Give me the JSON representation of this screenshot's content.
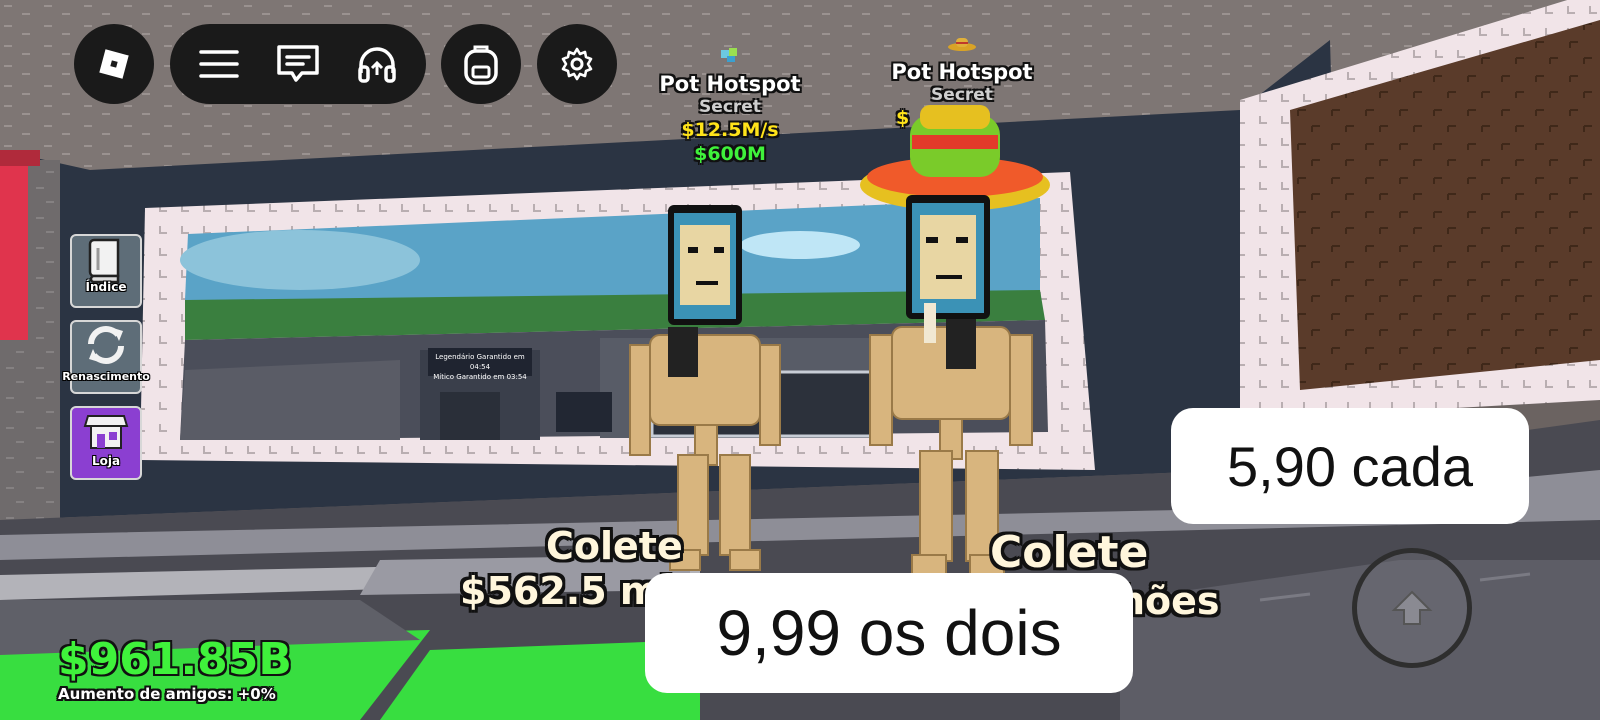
{
  "topbar": {
    "roblox_icon": "roblox-logo-icon",
    "menu_icon": "hamburger-menu-icon",
    "chat_icon": "chat-icon",
    "voice_icon": "headphones-icon",
    "backpack_icon": "backpack-icon",
    "settings_icon": "gear-icon"
  },
  "sidebar": {
    "items": [
      {
        "label": "Índice",
        "icon": "book-icon",
        "color": "#5e6d78"
      },
      {
        "label": "Renascimento",
        "icon": "refresh-icon",
        "color": "#5e6d78"
      },
      {
        "label": "Loja",
        "icon": "store-icon",
        "color": "#8b3fd1"
      }
    ]
  },
  "hotspots": [
    {
      "title": "Pot Hotspot",
      "rarity": "Secret",
      "rate": "$12.5M/s",
      "price": "$600M"
    },
    {
      "title": "Pot Hotspot",
      "rarity": "Secret",
      "rate": "$",
      "price": ""
    }
  ],
  "collect": [
    {
      "title": "Colete",
      "amount": "$562.5 mi"
    },
    {
      "title": "Colete",
      "amount": "hões"
    }
  ],
  "wallet": {
    "money": "$961.85B",
    "friend_boost": "Aumento de amigos: +0%"
  },
  "overlays": {
    "price_each": "5,90  cada",
    "price_both": "9,99 os dois"
  },
  "jump_button_icon": "jump-arrow-icon",
  "background_screen": {
    "line1": "Legendário Garantido em 04:54",
    "line2": "Mítico Garantido em 03:54"
  }
}
